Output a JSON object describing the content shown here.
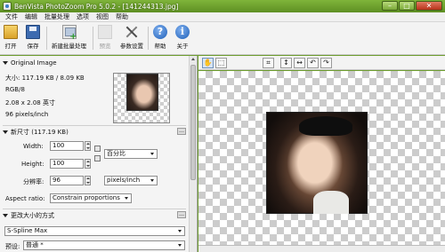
{
  "window": {
    "title": "BenVista PhotoZoom Pro 5.0.2 - [141244313.jpg]",
    "controls": {
      "minimize": "–",
      "maximize": "□",
      "close": "✕"
    }
  },
  "menu": [
    "文件",
    "编辑",
    "批量处理",
    "选项",
    "视图",
    "帮助"
  ],
  "toolbar": {
    "open": "打开",
    "save": "保存",
    "new_batch": "新建批量处理",
    "preview": "预览",
    "settings": "参数设置",
    "help": "帮助",
    "about": "关于"
  },
  "original_image": {
    "header": "Original Image",
    "size_line": "大小: 117.19 KB / 8.09 KB",
    "color_mode": "RGB/8",
    "dimensions": "2.08 x 2.08 英寸",
    "resolution": "96 pixels/inch"
  },
  "new_size": {
    "header": "新尺寸 (117.19 KB)",
    "width_label": "Width:",
    "width_value": "100",
    "height_label": "Height:",
    "height_value": "100",
    "unit": "百分比",
    "resolution_label": "分辨率:",
    "resolution_value": "96",
    "resolution_unit": "pixels/inch",
    "aspect_label": "Aspect ratio:",
    "aspect_value": "Constrain proportions"
  },
  "resize_method": {
    "header": "更改大小的方式",
    "method": "S-Spline Max",
    "preset_label": "预设:",
    "preset_value": "普通 *"
  },
  "view_toolbar": {
    "hand_icon": "✋",
    "select_icon": "⬚",
    "crop_icon": "⌗",
    "vertical_icon": "↕",
    "horizontal_icon": "↔",
    "rotate_left_icon": "↶",
    "rotate_right_icon": "↷"
  },
  "colors": {
    "titlebar": "#6e9e2e",
    "accent": "#1f5fb8"
  }
}
